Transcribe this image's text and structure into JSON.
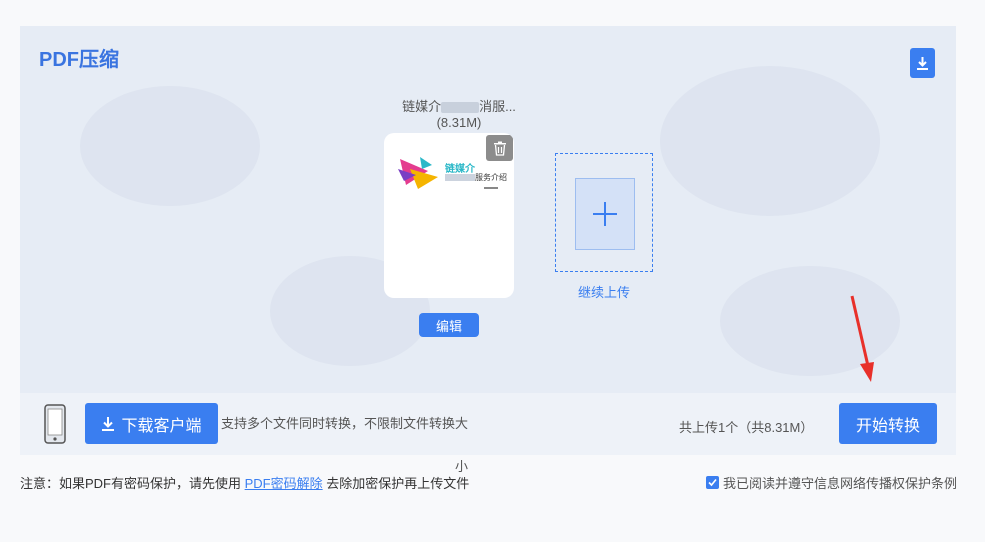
{
  "app": {
    "title": "PDF压缩"
  },
  "file": {
    "name_prefix": "链媒介",
    "name_suffix": "消服...",
    "size": "(8.31M)",
    "thumb_brand": "链媒介",
    "thumb_sub": "服务介绍"
  },
  "actions": {
    "edit_label": "编辑",
    "continue_upload_label": "继续上传",
    "download_client_label": "下载客户端",
    "start_label": "开始转换"
  },
  "bottom": {
    "support_text": "支持多个文件同时转换，不限制文件转换大",
    "support_tail": "小",
    "upload_count": "共上传1个（共8.31M）"
  },
  "notice": {
    "prefix": "注意：如果PDF有密码保护，请先使用 ",
    "link": "PDF密码解除",
    "suffix": " 去除加密保护再上传文件"
  },
  "agreement": {
    "checked": true,
    "label": "我已阅读并遵守信息网络传播权保护条例"
  },
  "colors": {
    "accent": "#3a7ef0",
    "arrow": "#e8302a"
  }
}
